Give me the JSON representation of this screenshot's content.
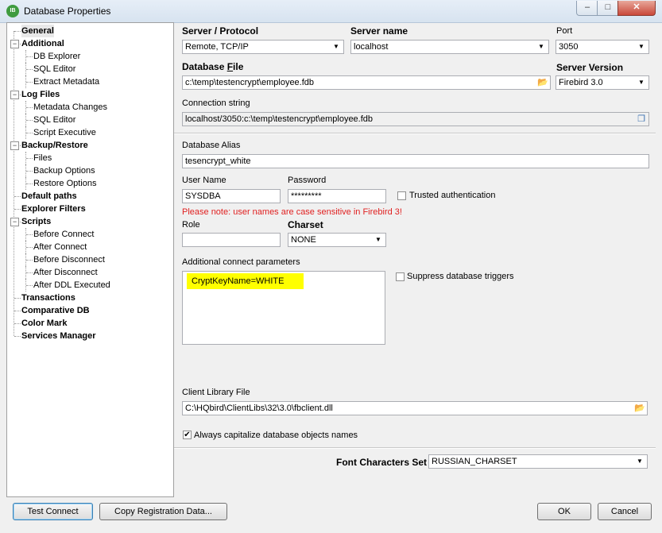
{
  "window": {
    "title": "Database Properties",
    "app_icon_text": "IB",
    "minimize": "‒",
    "maximize": "□",
    "close": "✕"
  },
  "tree": {
    "items": [
      {
        "label": "General",
        "level": 0,
        "selected": true,
        "expander": ""
      },
      {
        "label": "Additional",
        "level": 0,
        "expander": "−"
      },
      {
        "label": "DB Explorer",
        "level": 1
      },
      {
        "label": "SQL Editor",
        "level": 1
      },
      {
        "label": "Extract Metadata",
        "level": 1
      },
      {
        "label": "Log Files",
        "level": 0,
        "expander": "−"
      },
      {
        "label": "Metadata Changes",
        "level": 1
      },
      {
        "label": "SQL Editor",
        "level": 1
      },
      {
        "label": "Script Executive",
        "level": 1
      },
      {
        "label": "Backup/Restore",
        "level": 0,
        "expander": "−"
      },
      {
        "label": "Files",
        "level": 1
      },
      {
        "label": "Backup Options",
        "level": 1
      },
      {
        "label": "Restore Options",
        "level": 1
      },
      {
        "label": "Default paths",
        "level": 0,
        "expander": ""
      },
      {
        "label": "Explorer Filters",
        "level": 0,
        "expander": ""
      },
      {
        "label": "Scripts",
        "level": 0,
        "expander": "−"
      },
      {
        "label": "Before Connect",
        "level": 1
      },
      {
        "label": "After Connect",
        "level": 1
      },
      {
        "label": "Before Disconnect",
        "level": 1
      },
      {
        "label": "After Disconnect",
        "level": 1
      },
      {
        "label": "After DDL Executed",
        "level": 1
      },
      {
        "label": "Transactions",
        "level": 0,
        "expander": ""
      },
      {
        "label": "Comparative DB",
        "level": 0,
        "expander": ""
      },
      {
        "label": "Color Mark",
        "level": 0,
        "expander": ""
      },
      {
        "label": "Services Manager",
        "level": 0,
        "expander": ""
      }
    ]
  },
  "form": {
    "server_protocol_label": "Server / Protocol",
    "server_protocol_value": "Remote, TCP/IP",
    "server_name_label": "Server name",
    "server_name_value": "localhost",
    "port_label": "Port",
    "port_value": "3050",
    "database_file_label_pre": "Database ",
    "database_file_label_ul": "F",
    "database_file_label_post": "ile",
    "database_file_value": "c:\\temp\\testencrypt\\employee.fdb",
    "server_version_label": "Server Version",
    "server_version_value": "Firebird 3.0",
    "connection_string_label": "Connection string",
    "connection_string_value": "localhost/3050:c:\\temp\\testencrypt\\employee.fdb",
    "alias_label": "Database Alias",
    "alias_value": "tesencrypt_white",
    "username_label": "User Name",
    "username_value": "SYSDBA",
    "password_label": "Password",
    "password_value": "*********",
    "trusted_auth_label": "Trusted authentication",
    "case_warning": "Please note: user names are case sensitive in Firebird 3!",
    "role_label": "Role",
    "role_value": "",
    "charset_label": "Charset",
    "charset_value": "NONE",
    "additional_params_label": "Additional connect parameters",
    "additional_params_value": "CryptKeyName=WHITE",
    "suppress_triggers_label": "Suppress database triggers",
    "client_lib_label": "Client Library File",
    "client_lib_value": "C:\\HQbird\\ClientLibs\\32\\3.0\\fbclient.dll",
    "capitalize_label": "Always capitalize database objects names",
    "capitalize_checked": "✔",
    "font_charset_label": "Font Characters Set",
    "font_charset_value": "RUSSIAN_CHARSET"
  },
  "icons": {
    "combo_arrow": "▼",
    "folder": "📂",
    "copy": "❐"
  },
  "buttons": {
    "test_connect": "Test Connect",
    "copy_registration": "Copy Registration Data...",
    "ok": "OK",
    "cancel": "Cancel"
  },
  "colors": {
    "highlight": "#ffff00",
    "warning": "#e02020"
  }
}
